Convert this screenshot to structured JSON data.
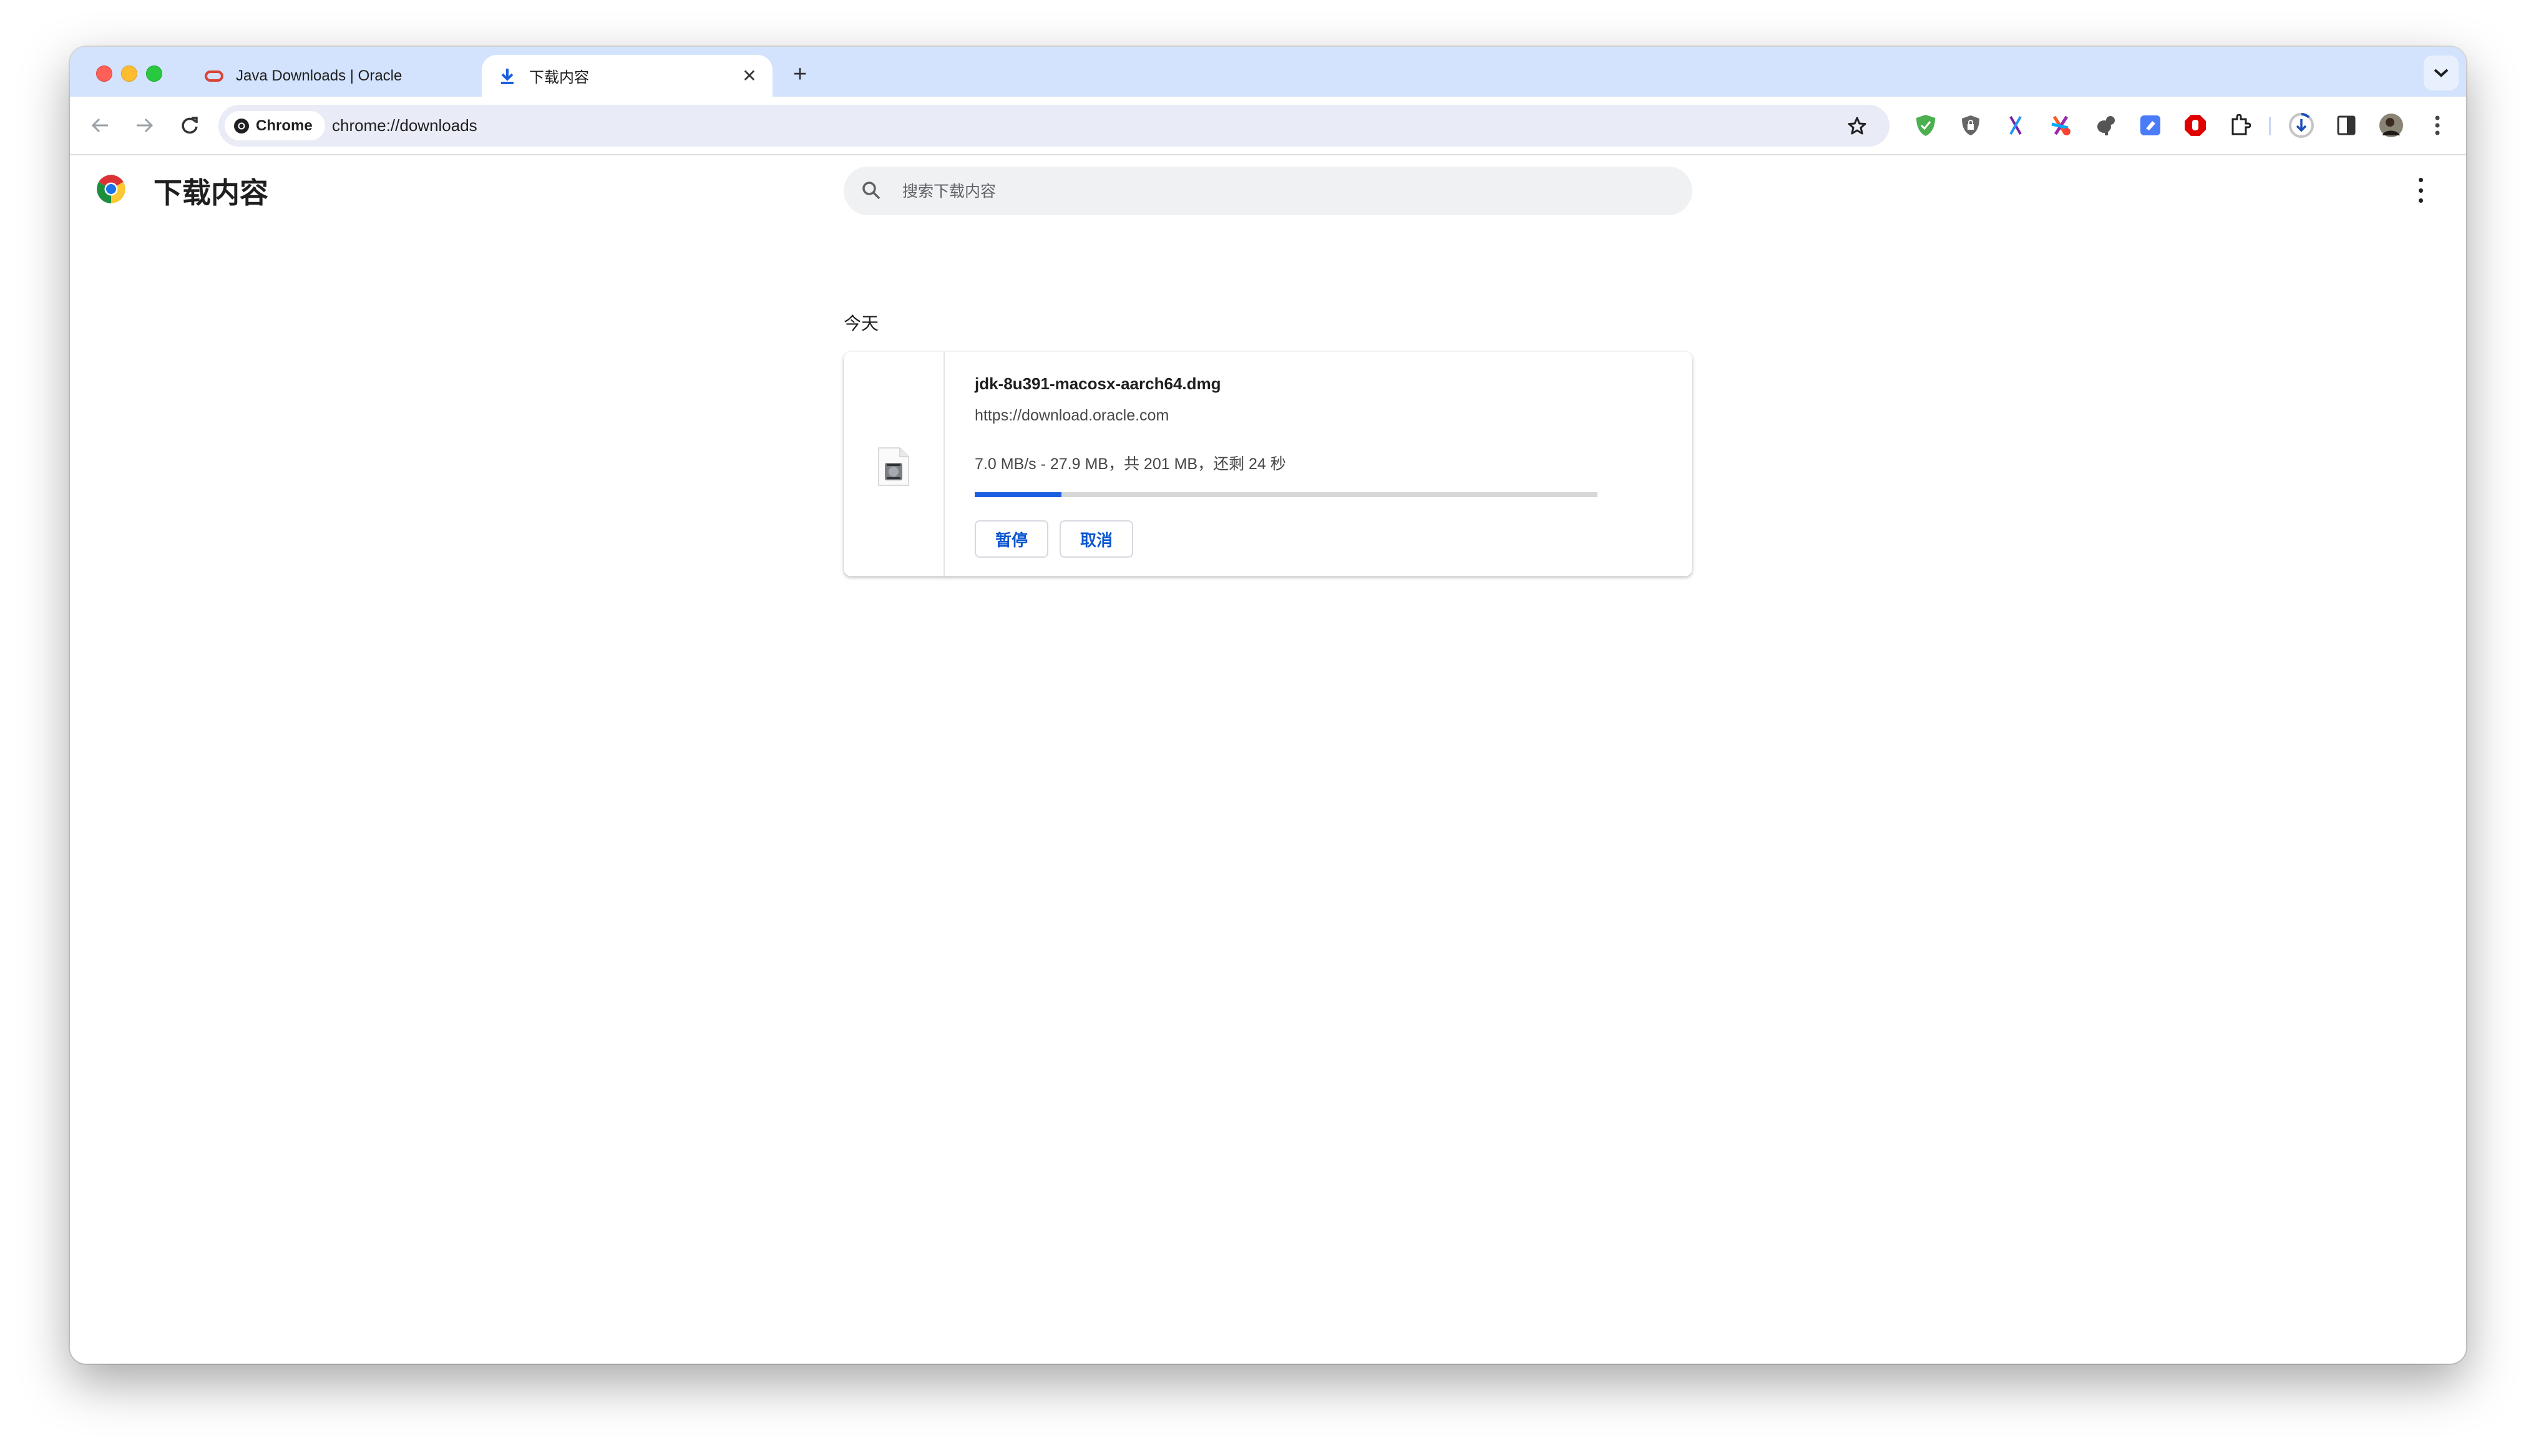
{
  "browser": {
    "tabs": [
      {
        "title": "Java Downloads | Oracle",
        "favicon": "oracle-logo-icon",
        "active": false
      },
      {
        "title": "下载内容",
        "favicon": "download-icon",
        "active": true
      }
    ],
    "new_tab_label": "+",
    "omnibox": {
      "chip_label": "Chrome",
      "url": "chrome://downloads"
    },
    "extensions": [
      "adguard-shield-icon",
      "privacy-shield-icon",
      "x-extension-icon",
      "colorful-star-extension-icon",
      "evernote-icon",
      "blue-eraser-extension-icon",
      "adblock-hand-icon",
      "puzzle-extensions-icon"
    ]
  },
  "page": {
    "title": "下载内容",
    "search_placeholder": "搜索下载内容",
    "section_label": "今天"
  },
  "downloads": [
    {
      "filename": "jdk-8u391-macosx-aarch64.dmg",
      "source_url": "https://download.oracle.com",
      "status": "7.0 MB/s - 27.9 MB，共 201 MB，还剩 24 秒",
      "progress_percent": 13.9,
      "pause_label": "暂停",
      "cancel_label": "取消"
    }
  ],
  "colors": {
    "accent": "#0b57d0",
    "progress": "#1a5fe0",
    "tabstrip": "#d3e3fd"
  }
}
